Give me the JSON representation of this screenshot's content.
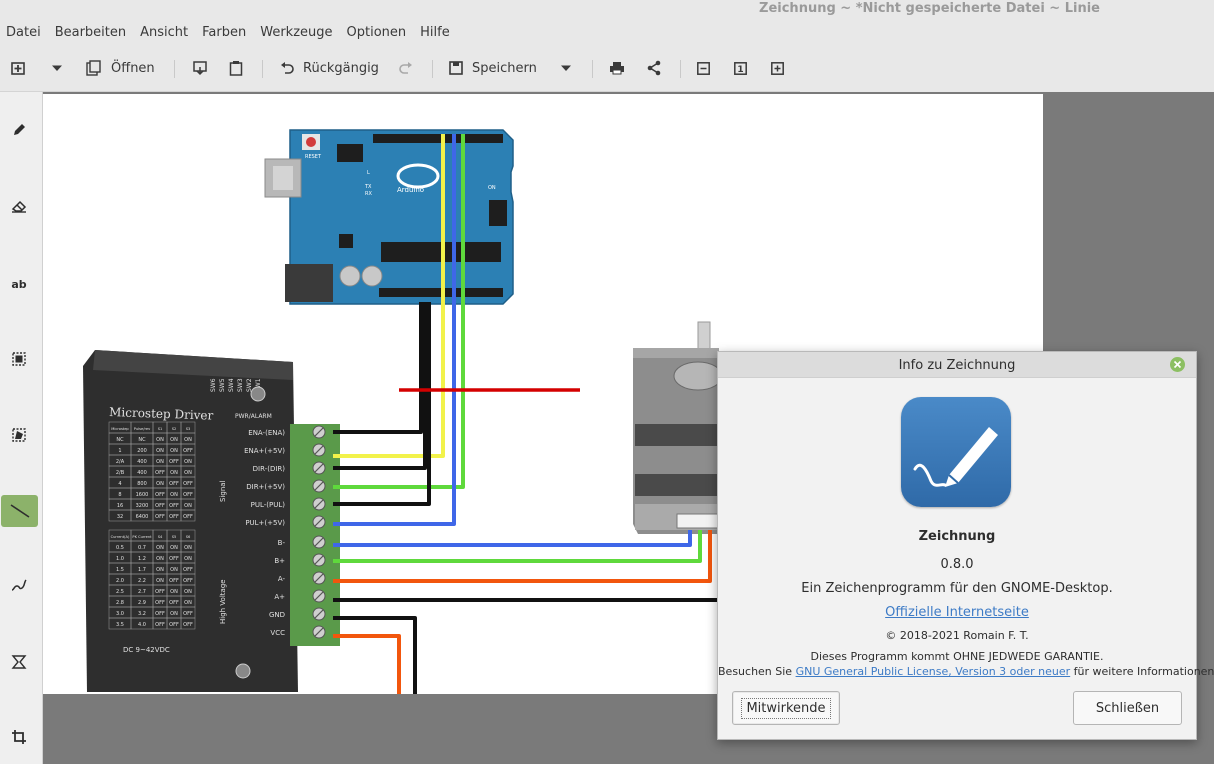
{
  "window": {
    "title": "Zeichnung ~ *Nicht gespeicherte Datei ~ Linie"
  },
  "menubar": [
    "Datei",
    "Bearbeiten",
    "Ansicht",
    "Farben",
    "Werkzeuge",
    "Optionen",
    "Hilfe"
  ],
  "toolbar": {
    "open_label": "Öffnen",
    "undo_label": "Rückgängig",
    "save_label": "Speichern",
    "zoom_level": "1"
  },
  "sidebar": {
    "tools": [
      "pencil-icon",
      "eraser-icon",
      "text-icon",
      "rectangle-selection-icon",
      "free-selection-icon",
      "line-icon",
      "curve-icon",
      "shape-icon",
      "crop-icon"
    ],
    "text_tool_label": "ab",
    "active_tool": "line"
  },
  "canvas": {
    "arduino": {
      "reset_label": "RESET",
      "brand": "Arduino",
      "on_label": "ON",
      "tx_label": "TX",
      "rx_label": "RX",
      "l_label": "L"
    },
    "driver": {
      "title": "Microstep Driver",
      "voltage": "DC 9~42VDC",
      "signal_label": "Signal",
      "hv_label": "High Voltage",
      "pwr_label": "PWR/ALARM",
      "switch_labels": [
        "SW6",
        "SW5",
        "SW4",
        "SW3",
        "SW2",
        "SW1"
      ],
      "terminals": [
        "ENA-(ENA)",
        "ENA+(+5V)",
        "DIR-(DIR)",
        "DIR+(+5V)",
        "PUL-(PUL)",
        "PUL+(+5V)",
        "B-",
        "B+",
        "A-",
        "A+",
        "GND",
        "VCC"
      ],
      "table1_head": [
        "Microstep",
        "Pulse/rev",
        "S1",
        "S2",
        "S3"
      ],
      "table1_rows": [
        [
          "NC",
          "NC",
          "ON",
          "ON",
          "ON"
        ],
        [
          "1",
          "200",
          "ON",
          "ON",
          "OFF"
        ],
        [
          "2/A",
          "400",
          "ON",
          "OFF",
          "ON"
        ],
        [
          "2/B",
          "400",
          "OFF",
          "ON",
          "ON"
        ],
        [
          "4",
          "800",
          "ON",
          "OFF",
          "OFF"
        ],
        [
          "8",
          "1600",
          "OFF",
          "ON",
          "OFF"
        ],
        [
          "16",
          "3200",
          "OFF",
          "OFF",
          "ON"
        ],
        [
          "32",
          "6400",
          "OFF",
          "OFF",
          "OFF"
        ]
      ],
      "table2_head": [
        "Current(A)",
        "PK Current",
        "S4",
        "S5",
        "S6"
      ],
      "table2_rows": [
        [
          "0.5",
          "0.7",
          "ON",
          "ON",
          "ON"
        ],
        [
          "1.0",
          "1.2",
          "ON",
          "OFF",
          "ON"
        ],
        [
          "1.5",
          "1.7",
          "ON",
          "ON",
          "OFF"
        ],
        [
          "2.0",
          "2.2",
          "ON",
          "OFF",
          "OFF"
        ],
        [
          "2.5",
          "2.7",
          "OFF",
          "ON",
          "ON"
        ],
        [
          "2.8",
          "2.9",
          "OFF",
          "OFF",
          "ON"
        ],
        [
          "3.0",
          "3.2",
          "OFF",
          "ON",
          "OFF"
        ],
        [
          "3.5",
          "4.0",
          "OFF",
          "OFF",
          "OFF"
        ]
      ]
    }
  },
  "dialog": {
    "title": "Info zu Zeichnung",
    "app_name": "Zeichnung",
    "version": "0.8.0",
    "description": "Ein Zeichenprogramm für den GNOME-Desktop.",
    "website_label": "Offizielle Internetseite",
    "copyright": "© 2018-2021 Romain F. T.",
    "warranty": "Dieses Programm kommt OHNE JEDWEDE GARANTIE.",
    "license_prefix": "Besuchen Sie ",
    "license_link": "GNU General Public License, Version 3 oder neuer",
    "license_suffix": " für weitere Informationen.",
    "credits_button": "Mitwirkende",
    "close_button": "Schließen"
  },
  "colors": {
    "accent_green": "#8cb26a",
    "board_blue": "#2c80b4",
    "wire_red": "#d40000",
    "wire_yellow": "#f2f24a",
    "wire_blue": "#3f67e8",
    "wire_green": "#5fd93c",
    "wire_orange": "#f2560d",
    "link_blue": "#3d7bc6"
  }
}
